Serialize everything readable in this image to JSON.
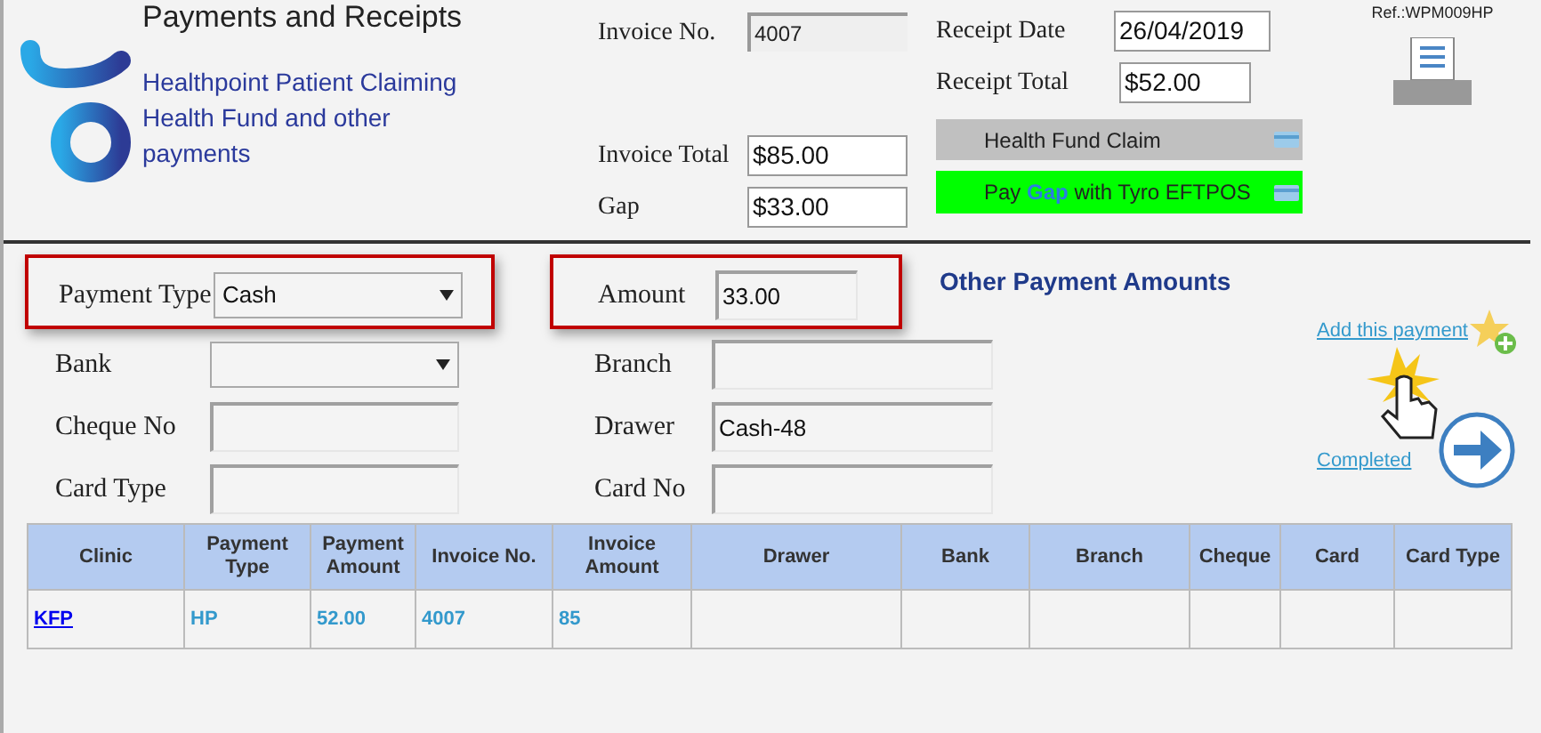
{
  "header": {
    "title": "Payments and Receipts",
    "subtitle": "Healthpoint Patient Claiming Health Fund and other payments",
    "ref": "Ref.:WPM009HP"
  },
  "invoice": [
    {
      "label": "Invoice No.",
      "value": "4007",
      "kind": "readonly"
    },
    {
      "label": "Invoice Total",
      "value": "$85.00",
      "kind": "input"
    },
    {
      "label": "Gap",
      "value": "$33.00",
      "kind": "input"
    }
  ],
  "receipt": [
    {
      "label": "Receipt Date",
      "value": "26/04/2019"
    },
    {
      "label": "Receipt Total",
      "value": "$52.00"
    }
  ],
  "actions": [
    {
      "kind": "fund",
      "text": "Health Fund Claim"
    },
    {
      "kind": "eftpos",
      "before": "Pay",
      "highlight": "Gap",
      "after": "with Tyro EFTPOS"
    }
  ],
  "payment_left": [
    {
      "label": "Payment Type",
      "kind": "select",
      "value": "Cash",
      "highlighted": true
    },
    {
      "label": "Bank",
      "kind": "select",
      "highlighted": false
    },
    {
      "label": "Cheque No",
      "kind": "input",
      "highlighted": false
    },
    {
      "label": "Card Type",
      "kind": "input",
      "highlighted": false
    }
  ],
  "payment_right": [
    {
      "label": "Amount",
      "kind": "short",
      "value": "33.00",
      "highlighted": true
    },
    {
      "label": "Branch",
      "kind": "input",
      "highlighted": false
    },
    {
      "label": "Drawer",
      "kind": "input",
      "value": "Cash-48",
      "highlighted": false
    },
    {
      "label": "Card No",
      "kind": "input",
      "highlighted": false
    }
  ],
  "other": {
    "title": "Other Payment Amounts",
    "add_link": "Add this payment",
    "completed_link": "Completed"
  },
  "table": {
    "columns": [
      "Clinic",
      "Payment Type",
      "Payment Amount",
      "Invoice No.",
      "Invoice Amount",
      "Drawer",
      "Bank",
      "Branch",
      "Cheque",
      "Card",
      "Card Type"
    ],
    "rows": [
      [
        {
          "kind": "link",
          "text": "KFP"
        },
        {
          "kind": "text",
          "text": "HP"
        },
        {
          "kind": "text",
          "text": "52.00"
        },
        {
          "kind": "text",
          "text": "4007"
        },
        {
          "kind": "text",
          "text": "85"
        },
        {
          "kind": "empty"
        },
        {
          "kind": "empty"
        },
        {
          "kind": "empty"
        },
        {
          "kind": "empty"
        },
        {
          "kind": "empty"
        },
        {
          "kind": "empty"
        }
      ]
    ]
  }
}
